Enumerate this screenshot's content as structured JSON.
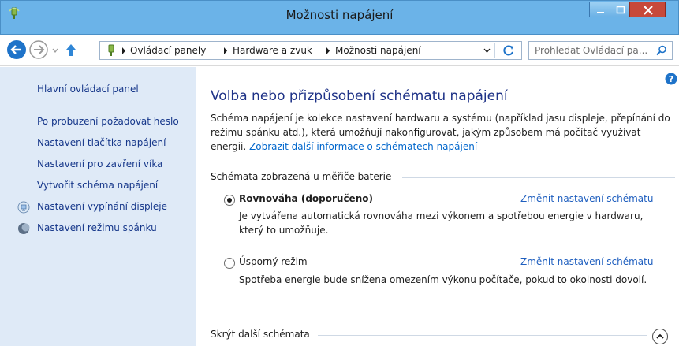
{
  "window": {
    "title": "Možnosti napájení"
  },
  "navbar": {
    "breadcrumbs": [
      "Ovládací panely",
      "Hardware a zvuk",
      "Možnosti napájení"
    ],
    "search_placeholder": "Prohledat Ovládací pa..."
  },
  "sidebar": {
    "home": "Hlavní ovládací panel",
    "items": [
      {
        "label": "Po probuzení požadovat heslo",
        "icon": null
      },
      {
        "label": "Nastavení tlačítka napájení",
        "icon": null
      },
      {
        "label": "Nastavení pro zavření víka",
        "icon": null
      },
      {
        "label": "Vytvořit schéma napájení",
        "icon": null
      },
      {
        "label": "Nastavení vypínání displeje",
        "icon": "display-icon"
      },
      {
        "label": "Nastavení režimu spánku",
        "icon": "sleep-moon-icon"
      }
    ]
  },
  "main": {
    "heading": "Volba nebo přizpůsobení schématu napájení",
    "description": "Schéma napájení je kolekce nastavení hardwaru a systému (například jasu displeje, přepínání do režimu spánku atd.), která umožňují nakonfigurovat, jakým způsobem má počítač využívat energii.",
    "description_link": "Zobrazit další informace o schématech napájení",
    "section_label": "Schémata zobrazená u měřiče baterie",
    "plans": [
      {
        "name": "Rovnováha (doporučeno)",
        "selected": true,
        "change_link": "Změnit nastavení schématu",
        "description": "Je vytvářena automatická rovnováha mezi výkonem a spotřebou energie v hardwaru, který to umožňuje."
      },
      {
        "name": "Úsporný režim",
        "selected": false,
        "change_link": "Změnit nastavení schématu",
        "description": "Spotřeba energie bude snížena omezením výkonu počítače, pokud to okolnosti dovolí."
      }
    ],
    "hide_more_label": "Skrýt další schémata"
  },
  "colors": {
    "titlebar": "#6bb3e8",
    "close_button": "#c7493a",
    "sidebar_bg": "#dfeaf7",
    "link": "#1f5fbf",
    "heading": "#1e3287"
  }
}
